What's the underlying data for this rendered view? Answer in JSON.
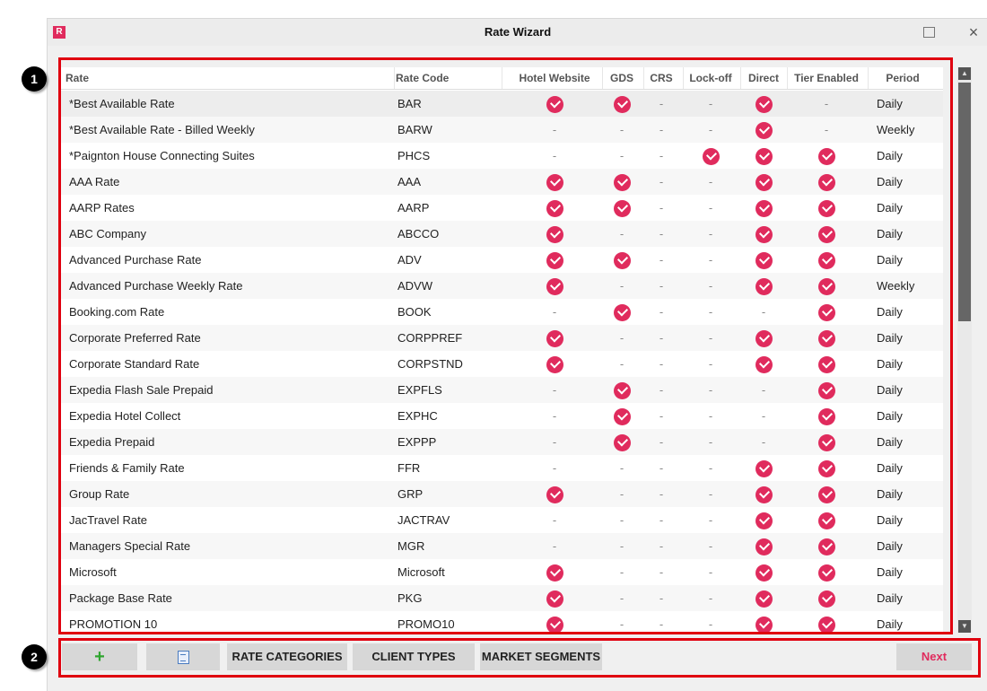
{
  "window": {
    "title": "Rate Wizard",
    "logo_letter": "R",
    "close_glyph": "×"
  },
  "colors": {
    "accent": "#e02b5d",
    "annotation": "#e0000f"
  },
  "table": {
    "headers": [
      "Rate",
      "Rate Code",
      "Hotel Website",
      "GDS",
      "CRS",
      "Lock-off",
      "Direct",
      "Tier Enabled",
      "Period"
    ],
    "dash": "-",
    "rows": [
      {
        "rate": "*Best Available Rate",
        "code": "BAR",
        "hotel_website": true,
        "gds": true,
        "crs": false,
        "lock_off": false,
        "direct": true,
        "tier_enabled": false,
        "period": "Daily"
      },
      {
        "rate": "*Best Available Rate - Billed Weekly",
        "code": "BARW",
        "hotel_website": false,
        "gds": false,
        "crs": false,
        "lock_off": false,
        "direct": true,
        "tier_enabled": false,
        "period": "Weekly"
      },
      {
        "rate": "*Paignton House Connecting Suites",
        "code": "PHCS",
        "hotel_website": false,
        "gds": false,
        "crs": false,
        "lock_off": true,
        "direct": true,
        "tier_enabled": true,
        "period": "Daily"
      },
      {
        "rate": "AAA Rate",
        "code": "AAA",
        "hotel_website": true,
        "gds": true,
        "crs": false,
        "lock_off": false,
        "direct": true,
        "tier_enabled": true,
        "period": "Daily"
      },
      {
        "rate": "AARP Rates",
        "code": "AARP",
        "hotel_website": true,
        "gds": true,
        "crs": false,
        "lock_off": false,
        "direct": true,
        "tier_enabled": true,
        "period": "Daily"
      },
      {
        "rate": "ABC Company",
        "code": "ABCCO",
        "hotel_website": true,
        "gds": false,
        "crs": false,
        "lock_off": false,
        "direct": true,
        "tier_enabled": true,
        "period": "Daily"
      },
      {
        "rate": "Advanced Purchase  Rate",
        "code": "ADV",
        "hotel_website": true,
        "gds": true,
        "crs": false,
        "lock_off": false,
        "direct": true,
        "tier_enabled": true,
        "period": "Daily"
      },
      {
        "rate": "Advanced Purchase Weekly Rate",
        "code": "ADVW",
        "hotel_website": true,
        "gds": false,
        "crs": false,
        "lock_off": false,
        "direct": true,
        "tier_enabled": true,
        "period": "Weekly"
      },
      {
        "rate": "Booking.com Rate",
        "code": "BOOK",
        "hotel_website": false,
        "gds": true,
        "crs": false,
        "lock_off": false,
        "direct": false,
        "tier_enabled": true,
        "period": "Daily"
      },
      {
        "rate": "Corporate Preferred Rate",
        "code": "CORPPREF",
        "hotel_website": true,
        "gds": false,
        "crs": false,
        "lock_off": false,
        "direct": true,
        "tier_enabled": true,
        "period": "Daily"
      },
      {
        "rate": "Corporate Standard  Rate",
        "code": "CORPSTND",
        "hotel_website": true,
        "gds": false,
        "crs": false,
        "lock_off": false,
        "direct": true,
        "tier_enabled": true,
        "period": "Daily"
      },
      {
        "rate": "Expedia Flash Sale Prepaid",
        "code": "EXPFLS",
        "hotel_website": false,
        "gds": true,
        "crs": false,
        "lock_off": false,
        "direct": false,
        "tier_enabled": true,
        "period": "Daily"
      },
      {
        "rate": "Expedia Hotel Collect",
        "code": "EXPHC",
        "hotel_website": false,
        "gds": true,
        "crs": false,
        "lock_off": false,
        "direct": false,
        "tier_enabled": true,
        "period": "Daily"
      },
      {
        "rate": "Expedia Prepaid",
        "code": "EXPPP",
        "hotel_website": false,
        "gds": true,
        "crs": false,
        "lock_off": false,
        "direct": false,
        "tier_enabled": true,
        "period": "Daily"
      },
      {
        "rate": "Friends & Family Rate",
        "code": "FFR",
        "hotel_website": false,
        "gds": false,
        "crs": false,
        "lock_off": false,
        "direct": true,
        "tier_enabled": true,
        "period": "Daily"
      },
      {
        "rate": "Group Rate",
        "code": "GRP",
        "hotel_website": true,
        "gds": false,
        "crs": false,
        "lock_off": false,
        "direct": true,
        "tier_enabled": true,
        "period": "Daily"
      },
      {
        "rate": "JacTravel Rate",
        "code": "JACTRAV",
        "hotel_website": false,
        "gds": false,
        "crs": false,
        "lock_off": false,
        "direct": true,
        "tier_enabled": true,
        "period": "Daily"
      },
      {
        "rate": "Managers Special Rate",
        "code": "MGR",
        "hotel_website": false,
        "gds": false,
        "crs": false,
        "lock_off": false,
        "direct": true,
        "tier_enabled": true,
        "period": "Daily"
      },
      {
        "rate": "Microsoft",
        "code": "Microsoft",
        "hotel_website": true,
        "gds": false,
        "crs": false,
        "lock_off": false,
        "direct": true,
        "tier_enabled": true,
        "period": "Daily"
      },
      {
        "rate": "Package Base Rate",
        "code": "PKG",
        "hotel_website": true,
        "gds": false,
        "crs": false,
        "lock_off": false,
        "direct": true,
        "tier_enabled": true,
        "period": "Daily"
      },
      {
        "rate": "PROMOTION 10",
        "code": "PROMO10",
        "hotel_website": true,
        "gds": false,
        "crs": false,
        "lock_off": false,
        "direct": true,
        "tier_enabled": true,
        "period": "Daily"
      }
    ]
  },
  "toolbar": {
    "add_icon": "+",
    "rate_categories": "RATE CATEGORIES",
    "client_types": "CLIENT TYPES",
    "market_segments": "MARKET SEGMENTS",
    "next": "Next"
  },
  "callouts": [
    "1",
    "2"
  ]
}
